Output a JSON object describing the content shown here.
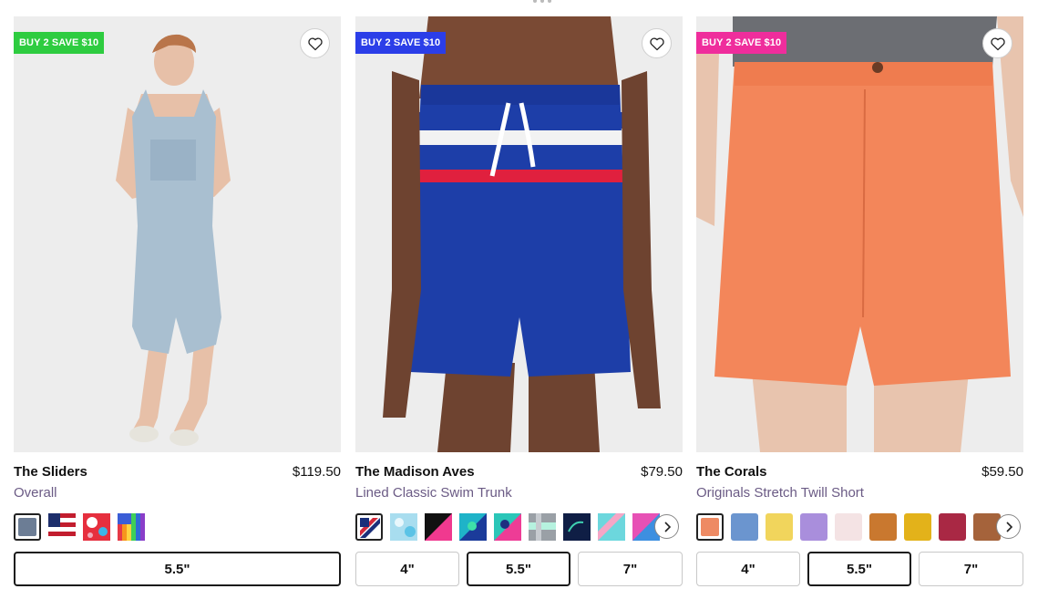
{
  "products": [
    {
      "name": "The Sliders",
      "price": "$119.50",
      "subtitle": "Overall",
      "badge": "BUY 2 SAVE $10",
      "badge_color": "#2ecc40",
      "sizes": [
        "5.5\""
      ],
      "selected_size": 0,
      "swatches": [
        "#6c7d95",
        "flag-stripes",
        "red-tie-dye",
        "rainbow-stripes"
      ],
      "selected_swatch": 0,
      "has_more_swatches": false
    },
    {
      "name": "The Madison Aves",
      "price": "$79.50",
      "subtitle": "Lined Classic Swim Trunk",
      "badge": "BUY 2 SAVE $10",
      "badge_color": "#2b3ee8",
      "sizes": [
        "4\"",
        "5.5\"",
        "7\""
      ],
      "selected_size": 1,
      "swatches": [
        "navy-red-stripes",
        "light-blue-pattern",
        "black-pink",
        "teal-blue-pattern",
        "pink-teal-pattern",
        "gray-mint-pattern",
        "navy-pattern",
        "pink-aqua",
        "magenta-blue"
      ],
      "selected_swatch": 0,
      "has_more_swatches": true
    },
    {
      "name": "The Corals",
      "price": "$59.50",
      "subtitle": "Originals Stretch Twill Short",
      "badge": "BUY 2 SAVE $10",
      "badge_color": "#ef2d9c",
      "sizes": [
        "4\"",
        "5.5\"",
        "7\""
      ],
      "selected_size": 1,
      "swatches": [
        "#ee8a63",
        "#6b95cf",
        "#f1d55c",
        "#a98edc",
        "#f4e3e4",
        "#c9782f",
        "#e3b21a",
        "#a92844",
        "#a5633b"
      ],
      "selected_swatch": 0,
      "has_more_swatches": true
    }
  ],
  "icons": {
    "wishlist": "heart-outline-icon",
    "carousel_next": "chevron-right-icon"
  }
}
